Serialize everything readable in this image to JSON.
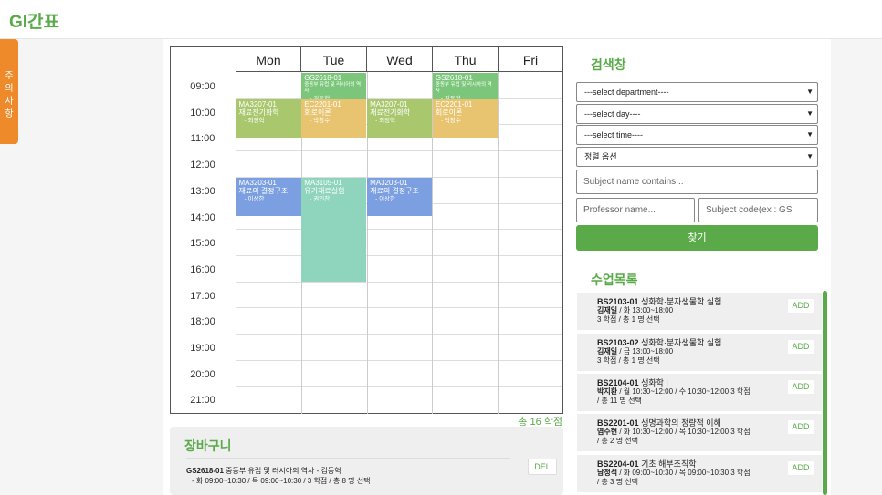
{
  "app": {
    "title": "GI간표"
  },
  "notice_tab": {
    "chars": [
      "주",
      "의",
      "사",
      "항"
    ]
  },
  "timetable": {
    "days": [
      "Mon",
      "Tue",
      "Wed",
      "Thu",
      "Fri"
    ],
    "times": [
      "09:00",
      "10:00",
      "11:00",
      "12:00",
      "13:00",
      "14:00",
      "15:00",
      "16:00",
      "17:00",
      "18:00",
      "19:00",
      "20:00",
      "21:00"
    ],
    "courses": [
      {
        "code": "GS2618-01",
        "title": "중동부 유럽 및 러시아의 역사",
        "prof": "- 김동혁",
        "day": "Tue",
        "start": "09:00",
        "end": "10:30",
        "color": "#7cc67c",
        "small": true
      },
      {
        "code": "GS2618-01",
        "title": "중동부 유럽 및 러시아의 역사",
        "prof": "- 김동혁",
        "day": "Thu",
        "start": "09:00",
        "end": "10:30",
        "color": "#7cc67c",
        "small": true
      },
      {
        "code": "MA3207-01",
        "title": "재료전기화학",
        "prof": "- 최정혁",
        "day": "Mon",
        "start": "10:00",
        "end": "11:30",
        "color": "#a9c76d"
      },
      {
        "code": "EC2201-01",
        "title": "회로이론",
        "prof": "- 박창수",
        "day": "Tue",
        "start": "10:00",
        "end": "11:30",
        "color": "#e8c471"
      },
      {
        "code": "MA3207-01",
        "title": "재료전기화학",
        "prof": "- 최정혁",
        "day": "Wed",
        "start": "10:00",
        "end": "11:30",
        "color": "#a9c76d"
      },
      {
        "code": "EC2201-01",
        "title": "회로이론",
        "prof": "- 박창수",
        "day": "Thu",
        "start": "10:00",
        "end": "11:30",
        "color": "#e8c471"
      },
      {
        "code": "MA3203-01",
        "title": "재료의 결정구조",
        "prof": "- 이상한",
        "day": "Mon",
        "start": "13:00",
        "end": "14:30",
        "color": "#7b9fe0"
      },
      {
        "code": "MA3105-01",
        "title": "유기재료실험",
        "prof": "- 권인찬",
        "day": "Tue",
        "start": "13:00",
        "end": "17:00",
        "color": "#8fd4bd"
      },
      {
        "code": "MA3203-01",
        "title": "재료의 결정구조",
        "prof": "- 이상한",
        "day": "Wed",
        "start": "13:00",
        "end": "14:30",
        "color": "#7b9fe0"
      }
    ],
    "total_credits": "총 16 학점"
  },
  "cart": {
    "title": "장바구니",
    "items": [
      {
        "code": "GS2618-01",
        "line1": "중동부 유럽 및 러시아의 역사 - 김동혁",
        "line2": "- 화 09:00~10:30 / 목 09:00~10:30 / 3 학점 / 총 8 명 선택",
        "del_label": "DEL"
      }
    ]
  },
  "search": {
    "title": "검색창",
    "department_select": "---select department----",
    "day_select": "---select day----",
    "time_select": "---select time----",
    "sort_select": "정렬 옵션",
    "subject_name_placeholder": "Subject name contains...",
    "professor_placeholder": "Professor name...",
    "subject_code_placeholder": "Subject code(ex : GS'",
    "find_label": "찾기"
  },
  "course_list": {
    "title": "수업목록",
    "add_label": "ADD",
    "items": [
      {
        "code": "BS2103-01",
        "name": "생화학·분자생물학 실험",
        "prof": "김재일",
        "detail": " / 화 13:00~18:00",
        "line3": "3 학점 / 총 1 명 선택"
      },
      {
        "code": "BS2103-02",
        "name": "생화학·분자생물학 실험",
        "prof": "김재일",
        "detail": " / 금 13:00~18:00",
        "line3": "3 학점 / 총 1 명 선택"
      },
      {
        "code": "BS2104-01",
        "name": "생화학 I",
        "prof": "박지환",
        "detail": " / 월 10:30~12:00 / 수 10:30~12:00 3 학점",
        "line3": "/ 총 11 명 선택"
      },
      {
        "code": "BS2201-01",
        "name": "생명과학의 정량적 이해",
        "prof": "염수현",
        "detail": " / 화 10:30~12:00 / 목 10:30~12:00 3 학점",
        "line3": "/ 총 2 명 선택"
      },
      {
        "code": "BS2204-01",
        "name": "기초 해부조직학",
        "prof": "남정석",
        "detail": " / 화 09:00~10:30 / 목 09:00~10:30 3 학점",
        "line3": "/ 총 3 명 선택"
      }
    ]
  }
}
